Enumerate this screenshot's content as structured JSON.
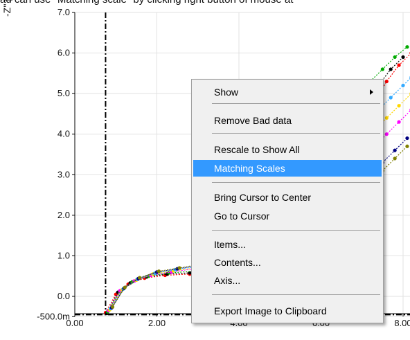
{
  "caption": "ad can use \"Matching scale\" by clicking right button of mouse at",
  "chart_data": {
    "type": "scatter",
    "ylabel": "-Z'' [",
    "x_ticks": [
      "0.00",
      "2.00",
      "4.00",
      "6.00",
      "8.00"
    ],
    "x_tick_values": [
      0,
      2,
      4,
      6,
      8
    ],
    "y_ticks": [
      "-500.0m",
      "0.0",
      "1.0",
      "2.0",
      "3.0",
      "4.0",
      "5.0",
      "6.0",
      "7.0"
    ],
    "y_tick_values": [
      -0.5,
      0,
      1,
      2,
      3,
      4,
      5,
      6,
      7
    ],
    "xlim": [
      0,
      8.2
    ],
    "ylim": [
      -0.5,
      7.0
    ],
    "grid": true,
    "cursor": {
      "x": 0.75,
      "y": -0.45
    },
    "series": [
      {
        "color": "#ff0000",
        "x": [
          0.75,
          1.0,
          1.3,
          1.7,
          2.2,
          2.8,
          3.0,
          7.0,
          7.3,
          7.6,
          7.9,
          8.2
        ],
        "y": [
          -0.4,
          0.05,
          0.3,
          0.45,
          0.52,
          0.55,
          0.55,
          4.3,
          4.8,
          5.3,
          5.7,
          6.0
        ]
      },
      {
        "color": "#000000",
        "x": [
          0.78,
          1.05,
          1.35,
          1.75,
          2.25,
          2.8,
          3.0,
          7.1,
          7.4,
          7.7,
          8.0
        ],
        "y": [
          -0.42,
          0.1,
          0.33,
          0.48,
          0.55,
          0.58,
          0.6,
          4.8,
          5.2,
          5.6,
          5.9
        ]
      },
      {
        "color": "#00aa00",
        "x": [
          0.8,
          1.1,
          1.4,
          1.8,
          2.3,
          2.9,
          3.0,
          7.2,
          7.5,
          7.8,
          8.1
        ],
        "y": [
          -0.38,
          0.12,
          0.36,
          0.5,
          0.58,
          0.62,
          0.62,
          5.3,
          5.6,
          5.9,
          6.15
        ]
      },
      {
        "color": "#ff00ff",
        "x": [
          0.82,
          1.1,
          1.45,
          1.85,
          2.35,
          2.9,
          3.0,
          7.3,
          7.6,
          7.9,
          8.2
        ],
        "y": [
          -0.35,
          0.14,
          0.38,
          0.52,
          0.6,
          0.68,
          0.7,
          3.7,
          4.0,
          4.3,
          4.6
        ]
      },
      {
        "color": "#ffd700",
        "x": [
          0.85,
          1.15,
          1.5,
          1.9,
          2.4,
          2.95,
          3.0,
          7.3,
          7.6,
          7.9,
          8.2
        ],
        "y": [
          -0.33,
          0.16,
          0.4,
          0.55,
          0.63,
          0.7,
          0.72,
          4.1,
          4.4,
          4.7,
          5.0
        ]
      },
      {
        "color": "#33aaff",
        "x": [
          0.87,
          1.18,
          1.52,
          1.95,
          2.45,
          3.0,
          7.4,
          7.7,
          8.0,
          8.2
        ],
        "y": [
          -0.3,
          0.18,
          0.42,
          0.57,
          0.66,
          0.74,
          4.6,
          4.9,
          5.2,
          5.4
        ]
      },
      {
        "color": "#000080",
        "x": [
          0.9,
          1.2,
          1.55,
          2.0,
          2.5,
          3.0,
          7.5,
          7.8,
          8.1
        ],
        "y": [
          -0.28,
          0.2,
          0.44,
          0.6,
          0.68,
          0.76,
          3.3,
          3.6,
          3.9
        ]
      },
      {
        "color": "#808000",
        "x": [
          0.92,
          1.22,
          1.58,
          2.05,
          2.55,
          3.0,
          7.5,
          7.8,
          8.1
        ],
        "y": [
          -0.26,
          0.22,
          0.46,
          0.62,
          0.7,
          0.78,
          3.1,
          3.4,
          3.7
        ]
      }
    ]
  },
  "context_menu": {
    "items": [
      {
        "label": "Show",
        "has_submenu": true,
        "highlighted": false
      },
      {
        "label": "Remove Bad data",
        "has_submenu": false,
        "highlighted": false
      },
      {
        "label": "Rescale to Show All",
        "has_submenu": false,
        "highlighted": false
      },
      {
        "label": "Matching Scales",
        "has_submenu": false,
        "highlighted": true
      },
      {
        "label": "Bring Cursor to Center",
        "has_submenu": false,
        "highlighted": false
      },
      {
        "label": "Go to Cursor",
        "has_submenu": false,
        "highlighted": false
      },
      {
        "label": "Items...",
        "has_submenu": false,
        "highlighted": false
      },
      {
        "label": "Contents...",
        "has_submenu": false,
        "highlighted": false
      },
      {
        "label": "Axis...",
        "has_submenu": false,
        "highlighted": false
      },
      {
        "label": "Export Image to Clipboard",
        "has_submenu": false,
        "highlighted": false
      }
    ],
    "highlight_color": "#3399ff"
  }
}
